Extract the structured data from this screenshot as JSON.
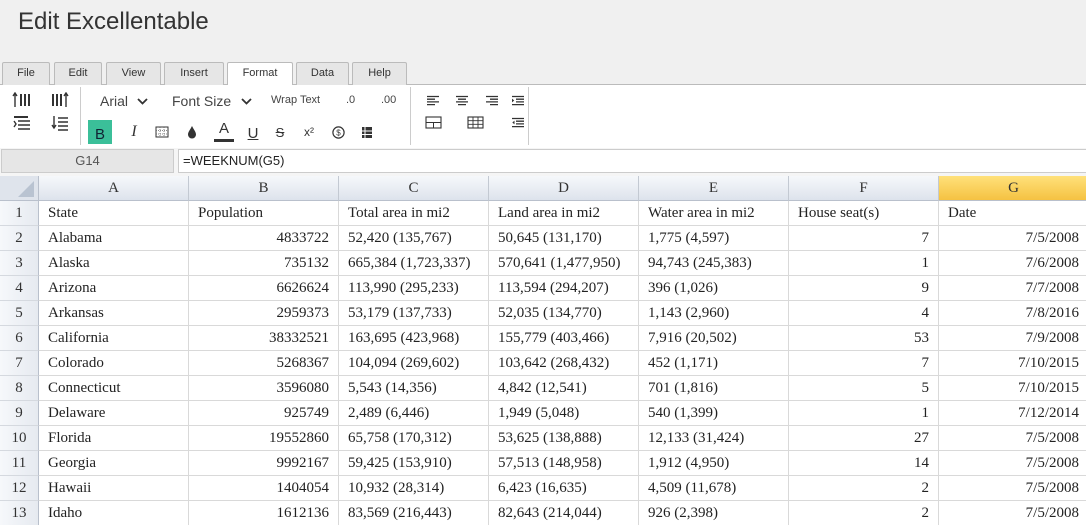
{
  "app": {
    "title": "Edit Excellentable"
  },
  "menu_tabs": [
    "File",
    "Edit",
    "View",
    "Insert",
    "Format",
    "Data",
    "Help"
  ],
  "active_tab": "Format",
  "toolbar": {
    "font_name": "Arial",
    "font_size": "Font Size",
    "wrap_text": "Wrap Text",
    "decrease_decimal": ".0",
    "increase_decimal": ".00",
    "bold": "B",
    "italic": "I",
    "font_color": "A",
    "underline": "U",
    "strikethrough": "S",
    "superscript": "x²",
    "highlight_color": "#3bbf99"
  },
  "formula_bar": {
    "cell_ref": "G14",
    "formula": "=WEEKNUM(G5)"
  },
  "sheet": {
    "columns": [
      "A",
      "B",
      "C",
      "D",
      "E",
      "F",
      "G"
    ],
    "selected_column": "G",
    "row_numbers": [
      "1",
      "2",
      "3",
      "4",
      "5",
      "6",
      "7",
      "8",
      "9",
      "10",
      "11",
      "12",
      "13"
    ],
    "rows": [
      [
        "State",
        "Population",
        "Total area in mi2",
        "Land area in mi2",
        "Water area in mi2",
        "House seat(s)",
        "Date"
      ],
      [
        "Alabama",
        "4833722",
        "52,420 (135,767)",
        "50,645 (131,170)",
        "1,775 (4,597)",
        "7",
        "7/5/2008"
      ],
      [
        "Alaska",
        "735132",
        "665,384 (1,723,337)",
        "570,641 (1,477,950)",
        "94,743 (245,383)",
        "1",
        "7/6/2008"
      ],
      [
        "Arizona",
        "6626624",
        "113,990 (295,233)",
        "113,594 (294,207)",
        "396 (1,026)",
        "9",
        "7/7/2008"
      ],
      [
        "Arkansas",
        "2959373",
        "53,179 (137,733)",
        "52,035 (134,770)",
        "1,143 (2,960)",
        "4",
        "7/8/2016"
      ],
      [
        "California",
        "38332521",
        "163,695 (423,968)",
        "155,779 (403,466)",
        "7,916 (20,502)",
        "53",
        "7/9/2008"
      ],
      [
        "Colorado",
        "5268367",
        "104,094 (269,602)",
        "103,642 (268,432)",
        "452 (1,171)",
        "7",
        "7/10/2015"
      ],
      [
        "Connecticut",
        "3596080",
        "5,543 (14,356)",
        "4,842 (12,541)",
        "701 (1,816)",
        "5",
        "7/10/2015"
      ],
      [
        "Delaware",
        "925749",
        "2,489 (6,446)",
        "1,949 (5,048)",
        "540 (1,399)",
        "1",
        "7/12/2014"
      ],
      [
        "Florida",
        "19552860",
        "65,758 (170,312)",
        "53,625 (138,888)",
        "12,133 (31,424)",
        "27",
        "7/5/2008"
      ],
      [
        "Georgia",
        "9992167",
        "59,425 (153,910)",
        "57,513 (148,958)",
        "1,912 (4,950)",
        "14",
        "7/5/2008"
      ],
      [
        "Hawaii",
        "1404054",
        "10,932 (28,314)",
        "6,423 (16,635)",
        "4,509 (11,678)",
        "2",
        "7/5/2008"
      ],
      [
        "Idaho",
        "1612136",
        "83,569 (216,443)",
        "82,643 (214,044)",
        "926 (2,398)",
        "2",
        "7/5/2008"
      ]
    ]
  }
}
